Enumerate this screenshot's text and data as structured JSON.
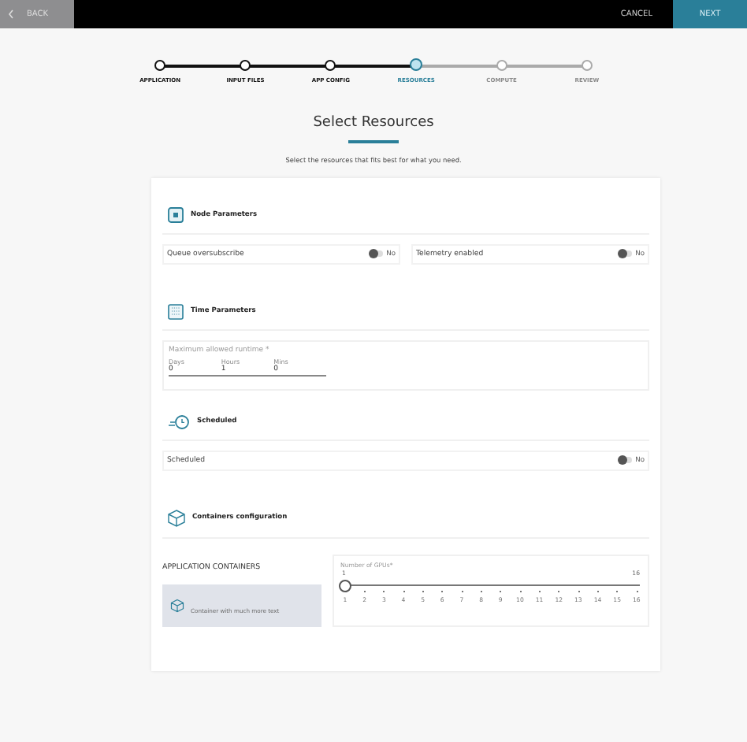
{
  "nav": {
    "back": "BACK",
    "cancel": "CANCEL",
    "next": "NEXT"
  },
  "steps": [
    {
      "label": "APPLICATION",
      "completed": true,
      "selected": false
    },
    {
      "label": "INPUT FILES",
      "completed": true,
      "selected": false
    },
    {
      "label": "APP CONFIG",
      "completed": true,
      "selected": false
    },
    {
      "label": "RESOURCES",
      "completed": false,
      "selected": true
    },
    {
      "label": "COMPUTE",
      "completed": false,
      "selected": false
    },
    {
      "label": "REVIEW",
      "completed": false,
      "selected": false
    }
  ],
  "title": "Select Resources",
  "subtitle": "Select the resources that fits best for what you need.",
  "sections": [
    {
      "kind": "toggles",
      "title": "Node Parameters",
      "toggles": [
        {
          "label": "Queue oversubscribe",
          "on": false,
          "value": "No"
        },
        {
          "label": "Telemetry enabled",
          "on": false,
          "value": "No"
        }
      ]
    },
    {
      "kind": "runtime",
      "title": "Time Parameters",
      "label": "Maximum allowed runtime *",
      "fields": [
        {
          "label": "Days",
          "value": "0"
        },
        {
          "label": "Hours",
          "value": "1"
        },
        {
          "label": "Mins",
          "value": "0"
        }
      ]
    },
    {
      "kind": "toggles",
      "title": "Scheduled",
      "toggles": [
        {
          "label": "Scheduled",
          "on": false,
          "value": "No"
        }
      ]
    },
    {
      "kind": "containers",
      "title": "Containers configuration",
      "heading": "APPLICATION CONTAINERS",
      "container": {
        "label": "Container with much more text",
        "selected": true
      },
      "gpu": {
        "label": "Number of GPUs*",
        "min": "1",
        "max": "16",
        "level": 0,
        "ticks": [
          "1",
          "2",
          "3",
          "4",
          "5",
          "6",
          "7",
          "8",
          "9",
          "10",
          "11",
          "12",
          "13",
          "14",
          "15",
          "16"
        ]
      }
    }
  ]
}
